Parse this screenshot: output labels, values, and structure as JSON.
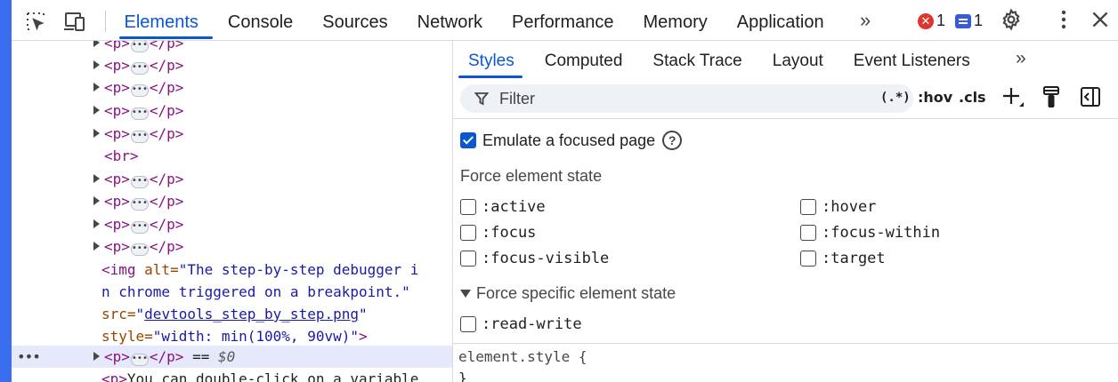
{
  "toolbar": {
    "tabs": [
      "Elements",
      "Console",
      "Sources",
      "Network",
      "Performance",
      "Memory",
      "Application"
    ],
    "more": "»",
    "error_count": "1",
    "message_count": "1"
  },
  "dom": {
    "lines": [
      {
        "indent": 1,
        "type": "collapsed",
        "open": "<p>",
        "close": "</p>"
      },
      {
        "indent": 1,
        "type": "collapsed",
        "open": "<p>",
        "close": "</p>"
      },
      {
        "indent": 1,
        "type": "collapsed",
        "open": "<p>",
        "close": "</p>"
      },
      {
        "indent": 1,
        "type": "collapsed",
        "open": "<p>",
        "close": "</p>"
      },
      {
        "indent": 1,
        "type": "collapsed",
        "open": "<p>",
        "close": "</p>"
      },
      {
        "indent": 1,
        "type": "leaf",
        "open": "<br>"
      },
      {
        "indent": 1,
        "type": "collapsed",
        "open": "<p>",
        "close": "</p>"
      },
      {
        "indent": 1,
        "type": "collapsed",
        "open": "<p>",
        "close": "</p>"
      },
      {
        "indent": 1,
        "type": "collapsed",
        "open": "<p>",
        "close": "</p>"
      },
      {
        "indent": 1,
        "type": "collapsed",
        "open": "<p>",
        "close": "</p>"
      }
    ],
    "img": {
      "tag_open": "<img",
      "alt_attr": " alt=",
      "alt_val_1": "\"The step-by-step debugger i",
      "alt_val_2": "n chrome triggered on a breakpoint.\"",
      "src_attr": "src=",
      "src_q1": "\"",
      "src_val": "devtools_step_by_step.png",
      "src_q2": "\"",
      "style_attr": "style=",
      "style_val": "\"width: min(100%, 90vw)\"",
      "tag_close": ">"
    },
    "selected": {
      "open": "<p>",
      "close": "</p>",
      "eq": " == ",
      "ref": "$0"
    },
    "last_line": {
      "open": "<p>",
      "text": "You can double-click on a variable"
    }
  },
  "styles_pane": {
    "tabs": [
      "Styles",
      "Computed",
      "Stack Trace",
      "Layout",
      "Event Listeners"
    ],
    "more": "»",
    "filter_placeholder": "Filter",
    "regex_label": "(.*)",
    "hov_label": ":hov",
    "cls_label": ".cls",
    "emulate_label": "Emulate a focused page",
    "help_glyph": "?",
    "force_state_title": "Force element state",
    "states_left": [
      ":active",
      ":focus",
      ":focus-visible"
    ],
    "states_right": [
      ":hover",
      ":focus-within",
      ":target"
    ],
    "specific_title": "Force specific element state",
    "specific_states": [
      ":read-write"
    ],
    "element_style": "element.style {",
    "element_close": "}"
  },
  "colors": {
    "accent": "#0b57d0",
    "left_strip": "#3a6df0",
    "error": "#dc362e",
    "selected_row": "#e5e9fb"
  }
}
